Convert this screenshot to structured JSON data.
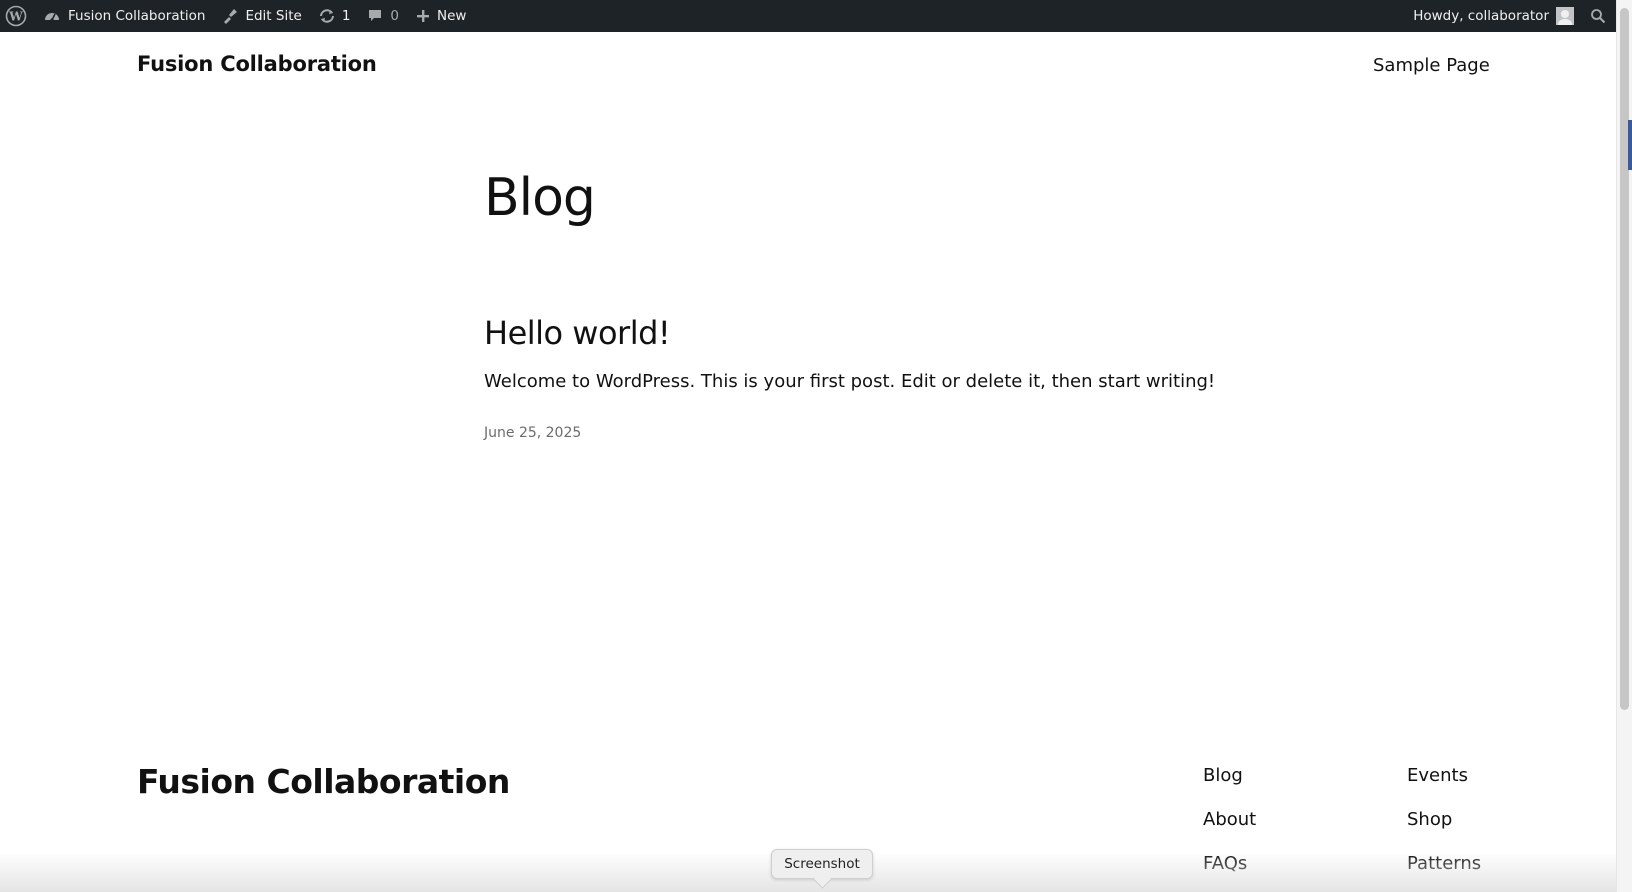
{
  "admin_bar": {
    "wp_logo_icon": "wordpress-logo-icon",
    "site_name": "Fusion Collaboration",
    "edit_site_label": "Edit Site",
    "updates_count": "1",
    "comments_count": "0",
    "new_label": "New",
    "greeting": "Howdy, collaborator"
  },
  "header": {
    "site_title": "Fusion Collaboration",
    "nav": [
      "Sample Page"
    ]
  },
  "main": {
    "page_heading": "Blog",
    "posts": [
      {
        "title": "Hello world!",
        "excerpt": "Welcome to WordPress. This is your first post. Edit or delete it, then start writing!",
        "date": "June 25, 2025"
      }
    ]
  },
  "footer": {
    "site_title": "Fusion Collaboration",
    "links_col1": [
      "Blog",
      "About",
      "FAQs"
    ],
    "links_col2": [
      "Events",
      "Shop",
      "Patterns"
    ]
  },
  "tooltip": {
    "label": "Screenshot"
  },
  "colors": {
    "admin_bar_bg": "#1d2327",
    "text": "#111111",
    "date": "#6b6b6b"
  }
}
